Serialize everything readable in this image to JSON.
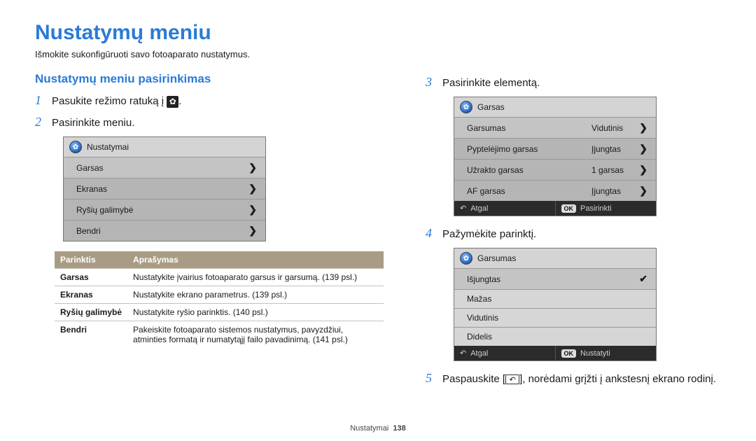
{
  "title": "Nustatymų meniu",
  "intro": "Išmokite sukonfigūruoti savo fotoaparato nustatymus.",
  "section_heading": "Nustatymų meniu pasirinkimas",
  "steps": {
    "s1": "Pasukite režimo ratuką į",
    "s1_suffix": ".",
    "s2": "Pasirinkite meniu.",
    "s3": "Pasirinkite elementą.",
    "s4": "Pažymėkite parinktį.",
    "s5a": "Paspauskite [",
    "s5b": "], norėdami grįžti į ankstesnį ekrano rodinį."
  },
  "box1": {
    "header": "Nustatymai",
    "rows": [
      "Garsas",
      "Ekranas",
      "Ryšių galimybė",
      "Bendri"
    ]
  },
  "opt_table": {
    "head": [
      "Parinktis",
      "Aprašymas"
    ],
    "rows": [
      [
        "Garsas",
        "Nustatykite įvairius fotoaparato garsus ir garsumą. (139 psl.)"
      ],
      [
        "Ekranas",
        "Nustatykite ekrano parametrus. (139 psl.)"
      ],
      [
        "Ryšių galimybė",
        "Nustatykite ryšio parinktis. (140 psl.)"
      ],
      [
        "Bendri",
        "Pakeiskite fotoaparato sistemos nustatymus, pavyzdžiui, atminties formatą ir numatytąjį failo pavadinimą. (141 psl.)"
      ]
    ]
  },
  "box2": {
    "header": "Garsas",
    "rows": [
      {
        "l": "Garsumas",
        "v": "Vidutinis"
      },
      {
        "l": "Pyptelėjimo garsas",
        "v": "Įjungtas"
      },
      {
        "l": "Užrakto garsas",
        "v": "1 garsas"
      },
      {
        "l": "AF garsas",
        "v": "Įjungtas"
      }
    ],
    "footer": {
      "back": "Atgal",
      "ok": "Pasirinkti"
    }
  },
  "box3": {
    "header": "Garsumas",
    "rows": [
      "Išjungtas",
      "Mažas",
      "Vidutinis",
      "Didelis"
    ],
    "footer": {
      "back": "Atgal",
      "ok": "Nustatyti"
    }
  },
  "footer": {
    "label": "Nustatymai",
    "page": "138"
  },
  "keys": {
    "ok": "OK"
  }
}
